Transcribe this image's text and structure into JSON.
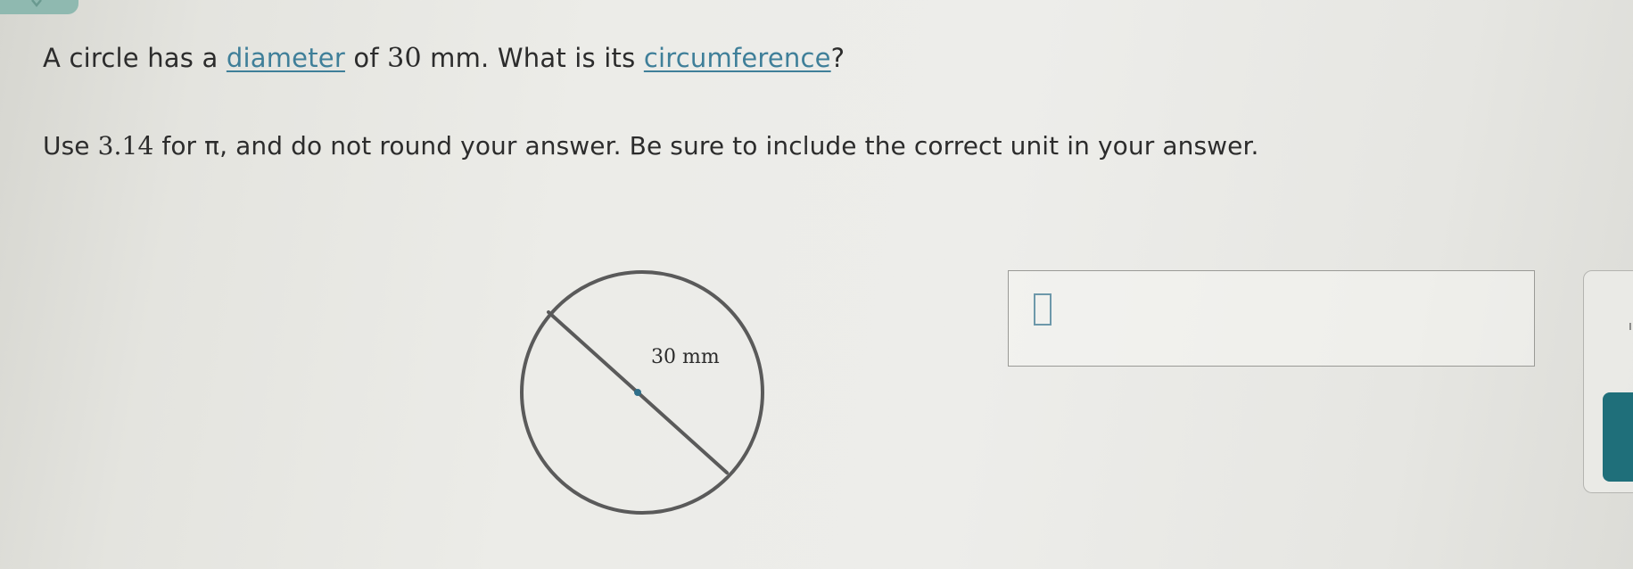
{
  "question": {
    "prefix": "A circle has a ",
    "diameter_link": "diameter",
    "middle": " of ",
    "value": "30",
    "unit_text": " mm. What is its ",
    "circumference_link": "circumference",
    "suffix": "?"
  },
  "instructions": {
    "prefix": "Use ",
    "pi_value": "3.14",
    "rest": " for π, and do not round your answer. Be sure to include the correct unit in your answer."
  },
  "figure": {
    "diameter_label": "30 mm"
  },
  "answer": {
    "value": ""
  },
  "right_panel": {
    "mark": "ı"
  },
  "colors": {
    "link": "#3f7f99",
    "circle_stroke": "#5a5a5a",
    "center_dot": "#2f6f8a",
    "input_border": "#6d98aa",
    "right_button": "#1f6f7a",
    "top_tab": "#8fb9b0"
  }
}
